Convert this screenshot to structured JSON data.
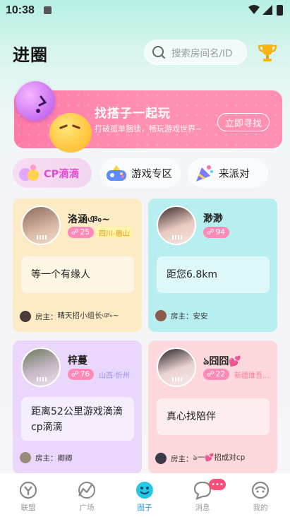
{
  "status_bar": {
    "time": "10:38"
  },
  "header": {
    "logo": "进圈",
    "search_placeholder": "搜索房间名/ID"
  },
  "banner": {
    "title": "找搭子一起玩",
    "subtitle": "打破孤单捆锁，畅玩游戏世界~",
    "cta": "立即寻找"
  },
  "tabs": [
    {
      "label": "CP滴滴",
      "active": true
    },
    {
      "label": "游戏专区",
      "active": false
    },
    {
      "label": "来派对",
      "active": false
    }
  ],
  "rooms": [
    {
      "name": "洛涵ঞ৹~",
      "count": "25",
      "location": "四川-眉山",
      "message": "等一个有缘人",
      "host_prefix": "房主：",
      "host": "晴天招小组长ঞ৹~",
      "bg": "#fdebc6",
      "loc_bg": "#fff4a8",
      "loc_color": "#e39a1c"
    },
    {
      "name": "渺渺",
      "count": "94",
      "location": "",
      "message": "距您6.8km",
      "host_prefix": "房主：",
      "host": "安安",
      "bg": "#b7eff1",
      "loc_bg": "",
      "loc_color": ""
    },
    {
      "name": "梓蔓",
      "count": "76",
      "location": "山西-忻州",
      "message": "距离52公里游戏滴滴cp滴滴",
      "host_prefix": "房主：",
      "host": "卿卿",
      "bg": "#ead7fb",
      "loc_bg": "#e4d8ff",
      "loc_color": "#a78be0"
    },
    {
      "name": "ঌ囧囧💕",
      "count": "22",
      "location": "新疆维吾...",
      "message": "真心找陪伴",
      "host_prefix": "房主：",
      "host": "ঌ一💕招成对cp",
      "bg": "#fdd8dc",
      "loc_bg": "#ffd6dd",
      "loc_color": "#f07f93"
    }
  ],
  "nav": [
    {
      "label": "联盟",
      "icon": "league-icon",
      "active": false
    },
    {
      "label": "广场",
      "icon": "square-icon",
      "active": false
    },
    {
      "label": "圈子",
      "icon": "circle-icon",
      "active": true
    },
    {
      "label": "消息",
      "icon": "message-icon",
      "active": false
    },
    {
      "label": "我的",
      "icon": "profile-icon",
      "active": false
    }
  ],
  "message_badge": "•••",
  "colors": {
    "accent": "#e44ad0",
    "banner": "#ff88ad",
    "nav_active": "#2a9be0"
  }
}
